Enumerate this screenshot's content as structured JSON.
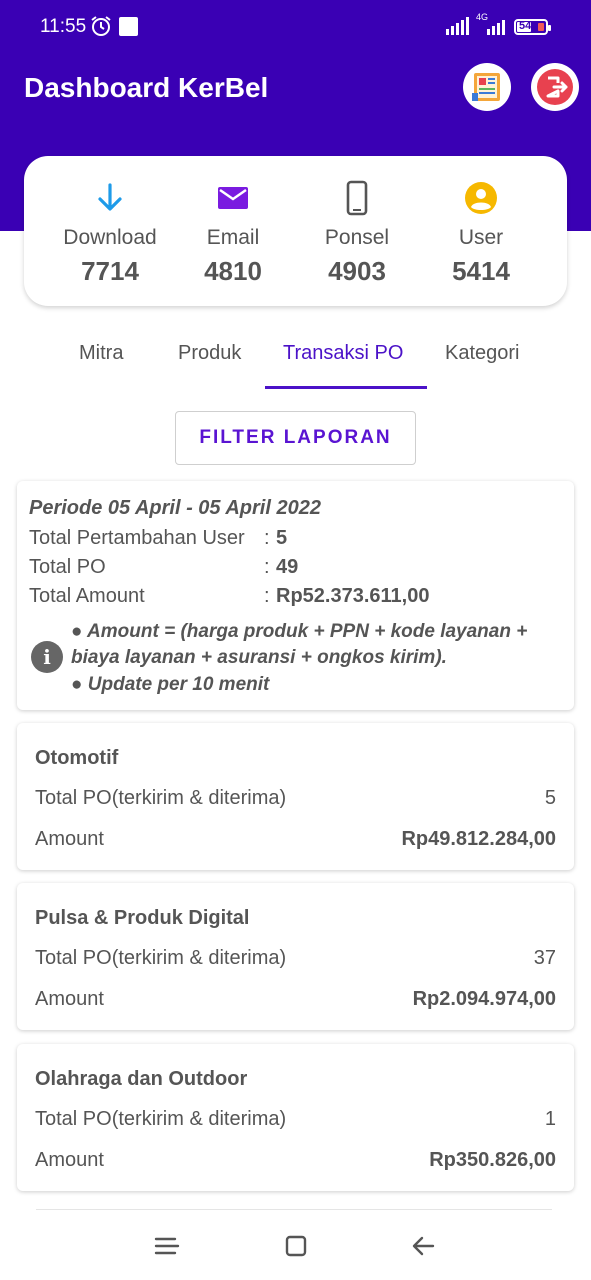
{
  "status_bar": {
    "time": "11:55",
    "network": "4G",
    "battery_level": "54"
  },
  "header": {
    "title": "Dashboard KerBel",
    "report_icon": "report-chart-icon",
    "logout_icon": "logout-icon"
  },
  "stats": {
    "download": {
      "label": "Download",
      "value": "7714",
      "icon": "download-arrow-icon"
    },
    "email": {
      "label": "Email",
      "value": "4810",
      "icon": "mail-icon"
    },
    "phone": {
      "label": "Ponsel",
      "value": "4903",
      "icon": "smartphone-icon"
    },
    "user": {
      "label": "User",
      "value": "5414",
      "icon": "user-icon"
    }
  },
  "tabs": [
    {
      "label": "Mitra"
    },
    {
      "label": "Produk"
    },
    {
      "label": "Transaksi PO"
    },
    {
      "label": "Kategori"
    }
  ],
  "active_tab": "Transaksi PO",
  "filter_button": "FILTER LAPORAN",
  "summary": {
    "period": "Periode 05 April - 05 April 2022",
    "rows": [
      {
        "label": "Total Pertambahan User",
        "value": "5"
      },
      {
        "label": "Total PO",
        "value": "49"
      },
      {
        "label": "Total Amount",
        "value": "Rp52.373.611,00"
      }
    ],
    "note_line1": "● Amount = (harga produk + PPN + kode layanan +",
    "note_line2": "biaya layanan + asuransi + ongkos kirim).",
    "note_line3": "● Update per 10 menit"
  },
  "categories": [
    {
      "name": "Otomotif",
      "po_label": "Total PO(terkirim & diterima)",
      "po_value": "5",
      "amount_label": "Amount",
      "amount_value": "Rp49.812.284,00"
    },
    {
      "name": "Pulsa & Produk Digital",
      "po_label": "Total PO(terkirim & diterima)",
      "po_value": "37",
      "amount_label": "Amount",
      "amount_value": "Rp2.094.974,00"
    },
    {
      "name": "Olahraga dan Outdoor",
      "po_label": "Total PO(terkirim & diterima)",
      "po_value": "1",
      "amount_label": "Amount",
      "amount_value": "Rp350.826,00"
    }
  ],
  "nav": {
    "menu_icon": "menu-icon",
    "home_icon": "home-square-icon",
    "back_icon": "back-arrow-icon"
  },
  "colors": {
    "primary": "#3a00b4",
    "accent": "#4b12c8",
    "download_icon": "#1e9be9",
    "email_icon": "#7a1be0",
    "user_icon": "#f6b800",
    "logout_icon": "#e8414f"
  }
}
